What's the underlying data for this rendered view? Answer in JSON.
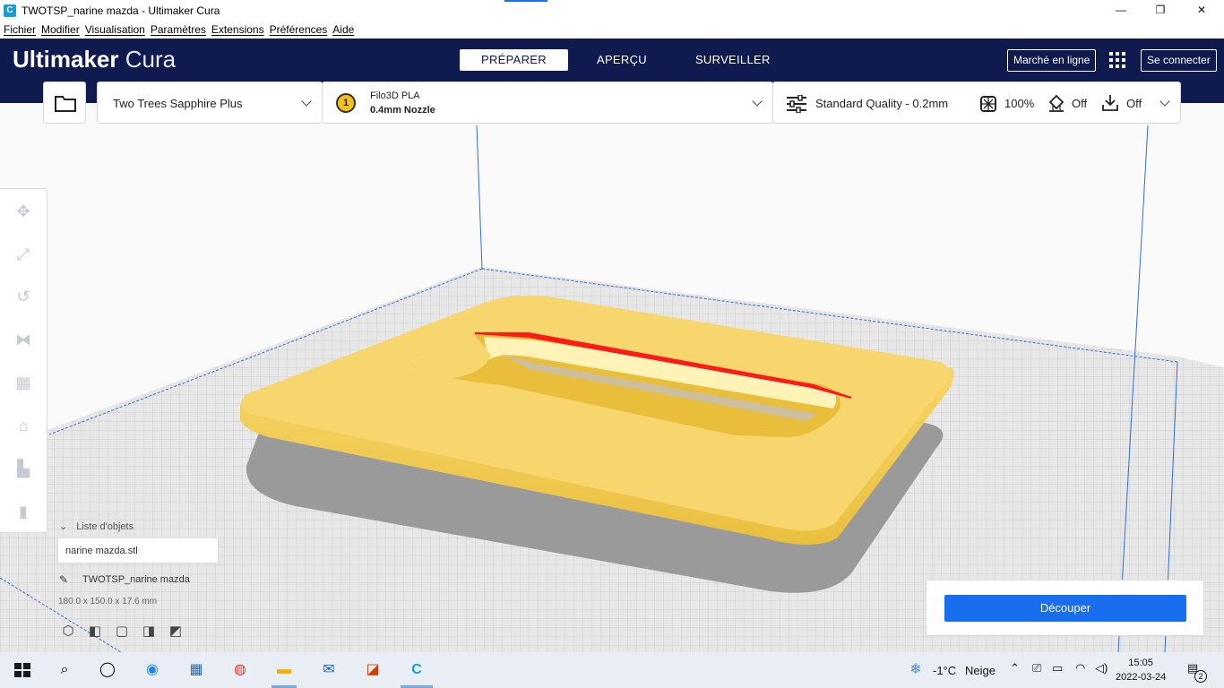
{
  "window": {
    "title": "TWOTSP_narine mazda - Ultimaker Cura",
    "minimize": "—",
    "maximize": "❐",
    "close": "✕"
  },
  "menu": [
    "Fichier",
    "Modifier",
    "Visualisation",
    "Paramètres",
    "Extensions",
    "Préférences",
    "Aide"
  ],
  "header": {
    "brand_bold": "Ultimaker",
    "brand_light": "Cura",
    "tabs": [
      "PRÉPARER",
      "APERÇU",
      "SURVEILLER"
    ],
    "active_tab": "PRÉPARER",
    "marketplace_label": "Marché en ligne",
    "signin_label": "Se connecter"
  },
  "toolbar": {
    "printer": "Two Trees Sapphire Plus",
    "extruder_number": "1",
    "material": "Filo3D PLA",
    "nozzle": "0.4mm Nozzle",
    "quality": "Standard Quality - 0.2mm",
    "infill": "100%",
    "support": "Off",
    "adhesion": "Off"
  },
  "objects": {
    "header": "Liste d'objets",
    "file": "narine mazda.stl",
    "job_name": "TWOTSP_narine mazda",
    "dimensions": "180.0 x 150.0 x 17.6 mm"
  },
  "slice": {
    "button_label": "Découper"
  },
  "taskbar": {
    "weather_temp": "-1°C",
    "weather_text": "Neige",
    "time": "15:05",
    "date": "2022-03-24",
    "notifications": "2"
  },
  "colors": {
    "header_bg": "#0f1a4e",
    "accent_blue": "#196ef0",
    "model_yellow": "#f4cf5a",
    "overhang_red": "#ff1a1a"
  }
}
